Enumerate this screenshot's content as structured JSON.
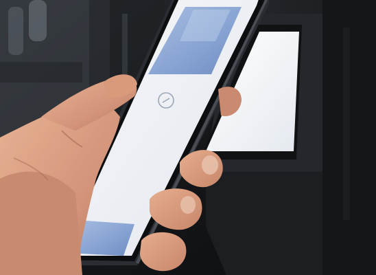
{
  "scene": {
    "description_icons": {
      "contactless_indicator": "contactless-icon"
    },
    "colors": {
      "background_dark": "#16181b",
      "terminal_screen": "#f3f5f8",
      "phone_screen": "#eef1f6",
      "wallet_card": "#8fa9d6",
      "skin": "#d99b7a"
    }
  }
}
